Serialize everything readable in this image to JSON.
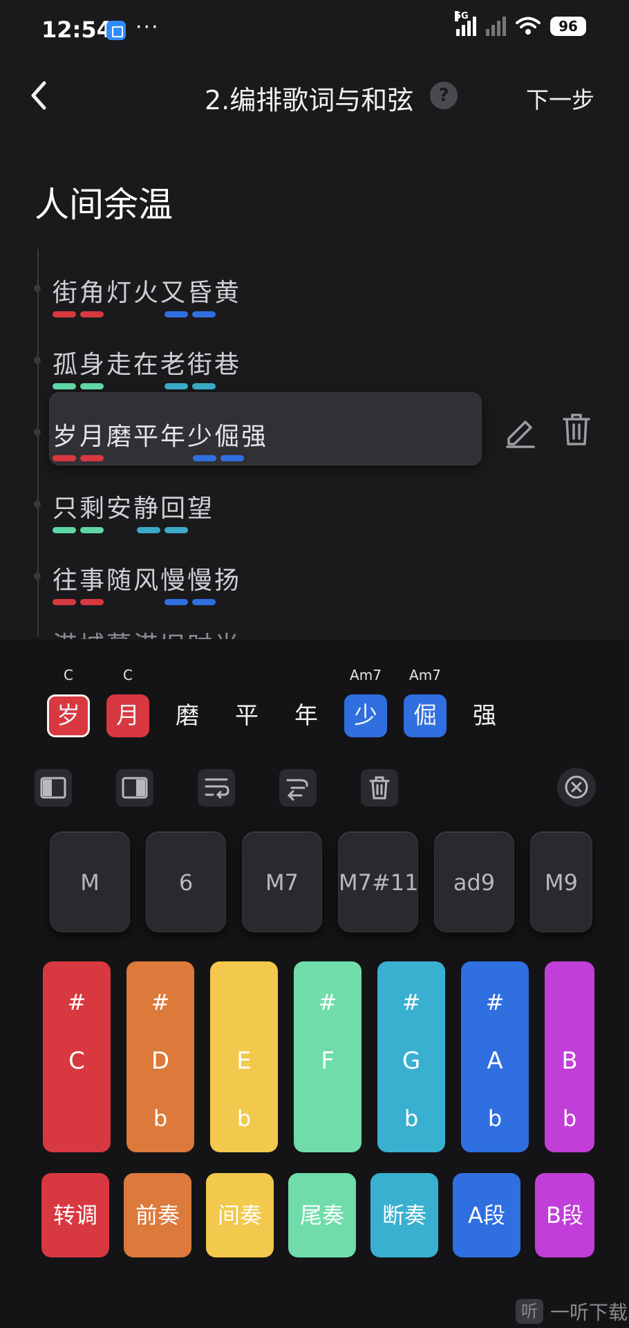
{
  "status_bar": {
    "time": "12:54",
    "dots": "···",
    "net_label": "5G",
    "battery": "96"
  },
  "nav": {
    "title": "2.编排歌词与和弦",
    "help": "?",
    "next": "下一步"
  },
  "song": {
    "title": "人间余温"
  },
  "lyrics": [
    {
      "text": "街角灯火又昏黄",
      "marks": [
        {
          "start": 0,
          "color": "#d8383f"
        },
        {
          "start": 4,
          "color": "#2f6fe0"
        }
      ]
    },
    {
      "text": "孤身走在老街巷",
      "marks": [
        {
          "start": 0,
          "color": "#5fd6a6"
        },
        {
          "start": 4,
          "color": "#3aaac6"
        }
      ]
    },
    {
      "text": "岁月磨平年少倔强",
      "marks": [
        {
          "start": 0,
          "color": "#d8383f"
        },
        {
          "start": 5,
          "color": "#2f6fe0"
        }
      ]
    },
    {
      "text": "只剩安静回望",
      "marks": [
        {
          "start": 0,
          "color": "#5fd6a6"
        },
        {
          "start": 3,
          "color": "#3aaac6"
        }
      ]
    },
    {
      "text": "往事随风慢慢扬",
      "marks": [
        {
          "start": 0,
          "color": "#d8383f"
        },
        {
          "start": 4,
          "color": "#2f6fe0"
        }
      ]
    }
  ],
  "faded_line": "港城暮港旧时光",
  "editor": {
    "words": [
      {
        "char": "岁",
        "chord": "C",
        "color": "#d8383f",
        "active": true
      },
      {
        "char": "月",
        "chord": "C",
        "color": "#d8383f",
        "active": false
      },
      {
        "char": "磨",
        "chord": "",
        "color": "",
        "active": false
      },
      {
        "char": "平",
        "chord": "",
        "color": "",
        "active": false
      },
      {
        "char": "年",
        "chord": "",
        "color": "",
        "active": false
      },
      {
        "char": "少",
        "chord": "Am7",
        "color": "#2f6fe0",
        "active": false
      },
      {
        "char": "倔",
        "chord": "Am7",
        "color": "#2f6fe0",
        "active": false
      },
      {
        "char": "强",
        "chord": "",
        "color": "",
        "active": false
      }
    ],
    "qualities": [
      "M",
      "6",
      "M7",
      "M7#11",
      "ad9",
      "M9"
    ],
    "notes": [
      {
        "sharp": "#",
        "name": "C",
        "flat": "",
        "color": "#d8383f"
      },
      {
        "sharp": "#",
        "name": "D",
        "flat": "b",
        "color": "#dc7a3c"
      },
      {
        "sharp": "",
        "name": "E",
        "flat": "b",
        "color": "#f2c94c"
      },
      {
        "sharp": "#",
        "name": "F",
        "flat": "",
        "color": "#6fdcaa"
      },
      {
        "sharp": "#",
        "name": "G",
        "flat": "b",
        "color": "#3ab0d0"
      },
      {
        "sharp": "#",
        "name": "A",
        "flat": "b",
        "color": "#2f6fe0"
      },
      {
        "sharp": "",
        "name": "B",
        "flat": "b",
        "color": "#c13fd8"
      }
    ],
    "sections": [
      {
        "label": "转调",
        "color": "#d8383f"
      },
      {
        "label": "前奏",
        "color": "#dc7a3c"
      },
      {
        "label": "间奏",
        "color": "#f2c94c"
      },
      {
        "label": "尾奏",
        "color": "#6fdcaa"
      },
      {
        "label": "断奏",
        "color": "#3ab0d0"
      },
      {
        "label": "A段",
        "color": "#2f6fe0"
      },
      {
        "label": "B段",
        "color": "#c13fd8"
      }
    ]
  },
  "watermark": {
    "icon": "听",
    "text": "一听下载"
  }
}
